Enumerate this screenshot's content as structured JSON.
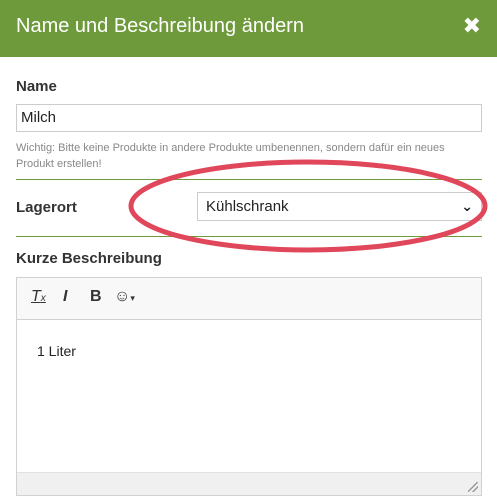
{
  "dialog": {
    "title": "Name und Beschreibung ändern",
    "close_icon": "close-icon",
    "header_color": "#6f9a3c"
  },
  "name_field": {
    "label": "Name",
    "value": "Milch",
    "hint": "Wichtig: Bitte keine Produkte in andere Produkte umbenennen, sondern dafür ein neues Produkt erstellen!"
  },
  "storage": {
    "label": "Lagerort",
    "selected": "Kühlschrank"
  },
  "description": {
    "label": "Kurze Beschreibung",
    "toolbar": {
      "clear_format": "T",
      "italic": "I",
      "bold": "B",
      "emoji_icon": "smiley-icon"
    },
    "content": "1 Liter"
  },
  "annotation": {
    "ellipse_color": "#e0475a"
  }
}
